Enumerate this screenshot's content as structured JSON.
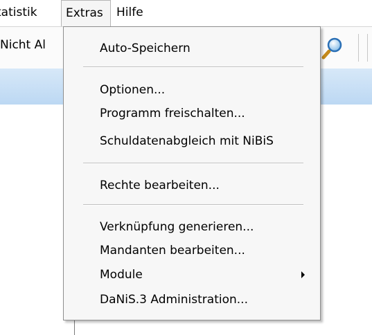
{
  "menubar": {
    "items": [
      {
        "label": "tatistik"
      },
      {
        "label": "Extras"
      },
      {
        "label": "Hilfe"
      }
    ]
  },
  "toolbar": {
    "cut_label": "Nicht Al",
    "search_icon": "magnifier-icon"
  },
  "extras_menu": {
    "items": [
      {
        "label": "Auto-Speichern"
      },
      {
        "label": "Optionen..."
      },
      {
        "label": "Programm freischalten..."
      },
      {
        "label": "Schuldatenabgleich mit NiBiS"
      },
      {
        "label": "Rechte bearbeiten..."
      },
      {
        "label": "Verknüpfung generieren..."
      },
      {
        "label": "Mandanten bearbeiten..."
      },
      {
        "label": "Module",
        "submenu_icon": "submenu-arrow-icon"
      },
      {
        "label": "DaNiS.3 Administration..."
      }
    ]
  },
  "colors": {
    "header_band": "#bcd8f3",
    "menu_background": "#f7f7f7",
    "menu_border": "#8e8e8e"
  }
}
